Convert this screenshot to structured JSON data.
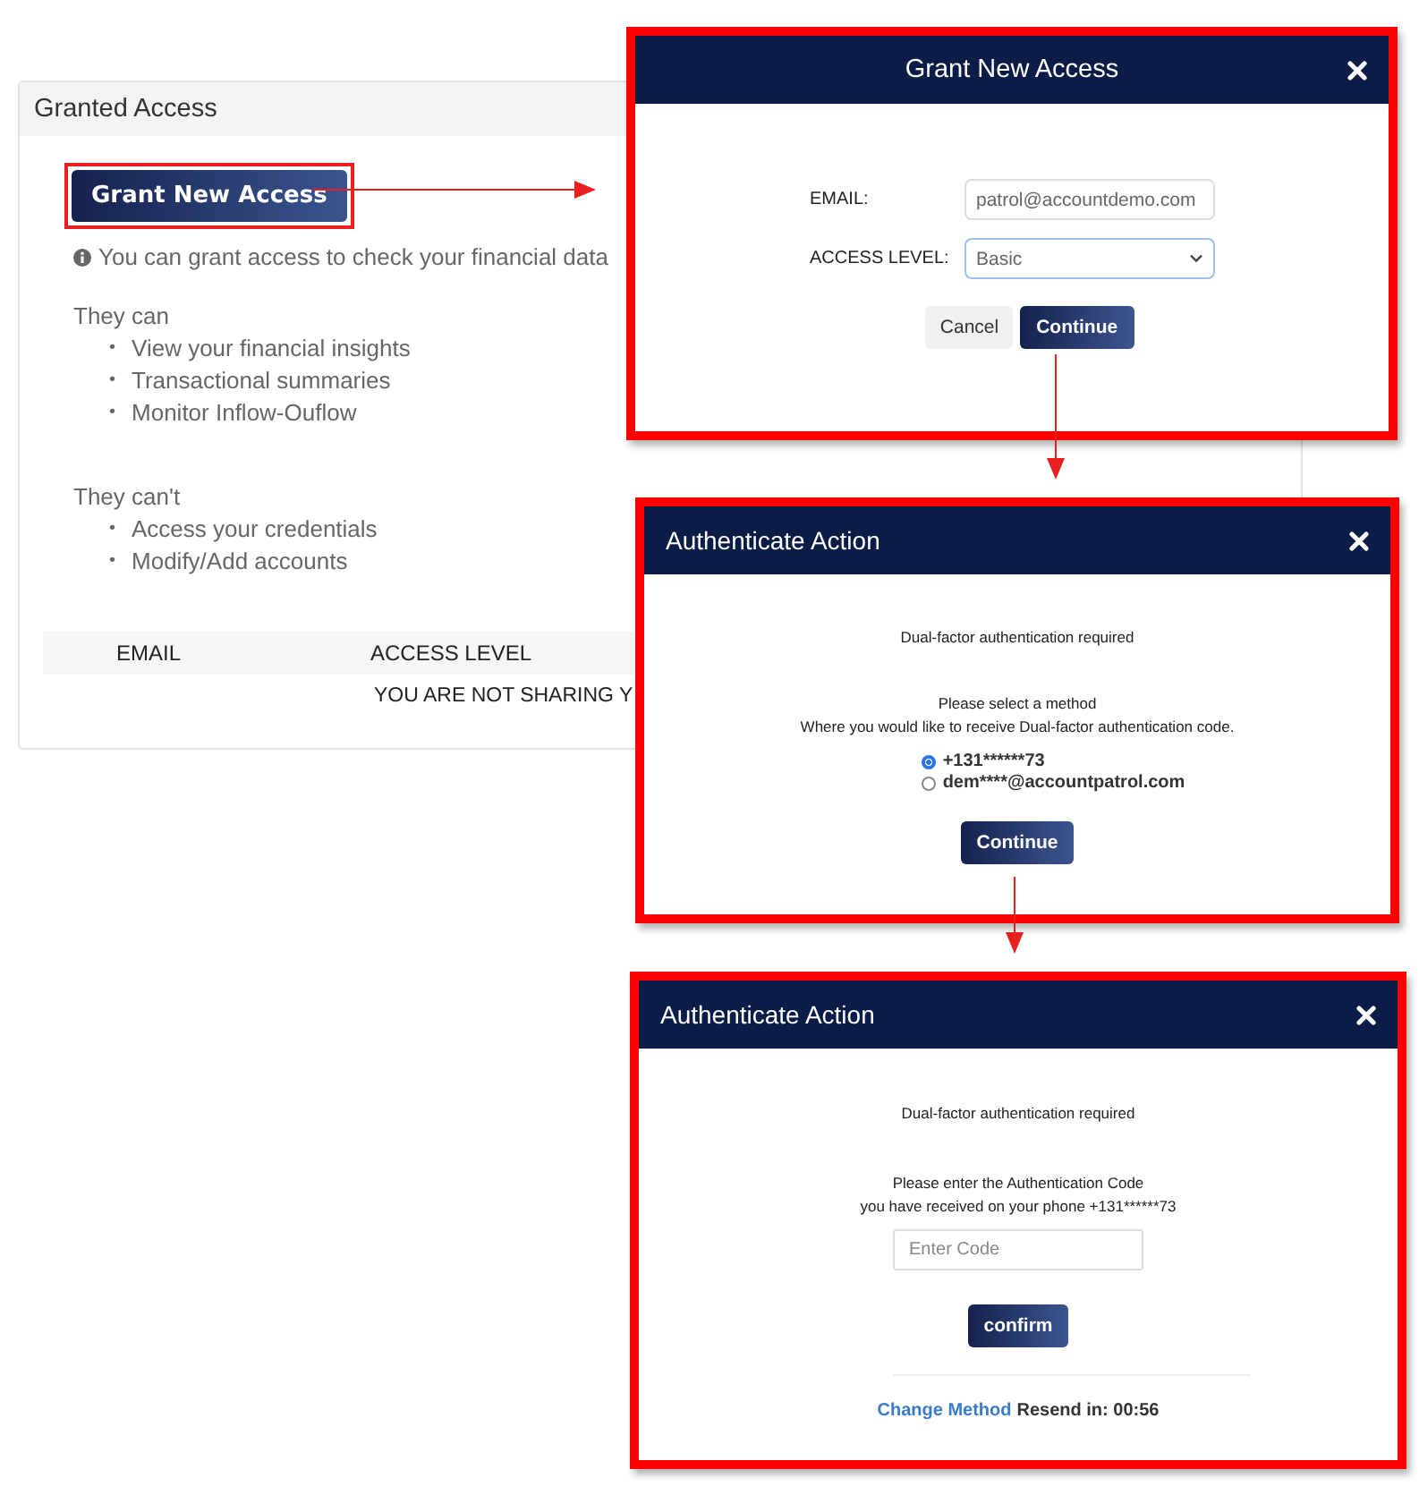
{
  "panel": {
    "title": "Granted Access",
    "grant_button": "Grant New Access",
    "info": "You can grant access to check your financial data",
    "can_heading": "They can",
    "can_items": [
      {
        "bullet": "•",
        "text": "View your financial insights"
      },
      {
        "bullet": "•",
        "text": "Transactional summaries"
      },
      {
        "bullet": "•",
        "text": "Monitor Inflow-Ouflow"
      }
    ],
    "cannot_heading": "They can't",
    "cannot_items": [
      {
        "bullet": "•",
        "text": "Access your credentials"
      },
      {
        "bullet": "•",
        "text": "Modify/Add accounts"
      }
    ],
    "table": {
      "columns": [
        "EMAIL",
        "ACCESS LEVEL"
      ],
      "empty_message": "YOU ARE NOT SHARING Y"
    }
  },
  "grant_modal": {
    "title": "Grant New Access",
    "email_label": "EMAIL:",
    "email_value": "patrol@accountdemo.com",
    "level_label": "ACCESS LEVEL:",
    "level_value": "Basic",
    "cancel": "Cancel",
    "continue": "Continue"
  },
  "method_modal": {
    "title": "Authenticate Action",
    "notice": "Dual-factor authentication required",
    "prompt": "Please select a method",
    "prompt_detail": "Where you would like to receive Dual-factor authentication code.",
    "methods": [
      {
        "label": "+131******73",
        "selected": true
      },
      {
        "label": "dem****@accountpatrol.com",
        "selected": false
      }
    ],
    "continue": "Continue"
  },
  "code_modal": {
    "title": "Authenticate Action",
    "notice": "Dual-factor authentication required",
    "prompt": "Please enter the Authentication Code",
    "prompt_detail": "you have received on your phone +131******73",
    "placeholder": "Enter Code",
    "confirm": "confirm",
    "change_link": "Change Method",
    "resend": "Resend in: 00:56"
  }
}
